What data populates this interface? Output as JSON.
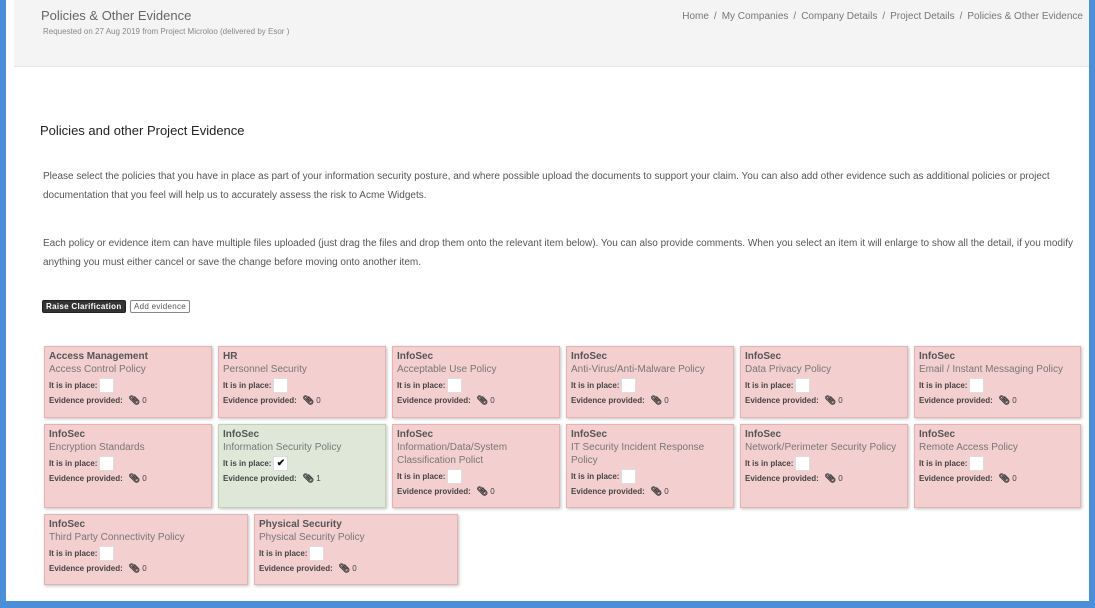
{
  "header": {
    "title": "Policies & Other Evidence",
    "subtitle": "Requested on 27 Aug 2019 from Project Microloo (delivered by Esor )",
    "breadcrumb": [
      "Home",
      "My Companies",
      "Company Details",
      "Project Details",
      "Policies & Other Evidence"
    ],
    "separator": "/"
  },
  "main": {
    "section_title": "Policies and other Project Evidence",
    "paragraph1": "Please select the policies that you have in place as part of your information security posture, and where possible upload the documents to support your claim. You can also add other evidence such as additional policies or project documentation that you feel will help us to accurately assess the risk to Acme Widgets.",
    "paragraph2": "Each policy or evidence item can have multiple files uploaded (just drag the files and drop them onto the relevant item below). You can also provide comments. When you select an item it will enlarge to show all the detail, if you modify anything you must either cancel or save the change before moving onto another item.",
    "raise_label": "Raise Clarification",
    "add_label": "Add evidence"
  },
  "labels": {
    "in_place": "It is in place:",
    "evidence": "Evidence provided:"
  },
  "colors": {
    "missing_card": "#f3cfcf",
    "provided_card": "#dfe8d8",
    "frame": "#4a8fd8"
  },
  "cards": [
    {
      "category": "Access Management",
      "name": "Access Control Policy",
      "checked": false,
      "check_mark": "",
      "evidence_count": "0"
    },
    {
      "category": "HR",
      "name": "Personnel Security",
      "checked": false,
      "check_mark": "",
      "evidence_count": "0"
    },
    {
      "category": "InfoSec",
      "name": "Acceptable Use Policy",
      "checked": false,
      "check_mark": "",
      "evidence_count": "0"
    },
    {
      "category": "InfoSec",
      "name": "Anti-Virus/Anti-Malware Policy",
      "checked": false,
      "check_mark": "",
      "evidence_count": "0"
    },
    {
      "category": "InfoSec",
      "name": "Data Privacy Policy",
      "checked": false,
      "check_mark": "",
      "evidence_count": "0"
    },
    {
      "category": "InfoSec",
      "name": "Email / Instant Messaging Policy",
      "checked": false,
      "check_mark": "",
      "evidence_count": "0"
    },
    {
      "category": "InfoSec",
      "name": "Encryption Standards",
      "checked": false,
      "check_mark": "",
      "evidence_count": "0"
    },
    {
      "category": "InfoSec",
      "name": "Information Security Policy",
      "checked": true,
      "check_mark": "✔",
      "evidence_count": "1"
    },
    {
      "category": "InfoSec",
      "name": "Information/Data/System Classification Polict",
      "checked": false,
      "check_mark": "",
      "evidence_count": "0"
    },
    {
      "category": "InfoSec",
      "name": "IT Security Incident Response Policy",
      "checked": false,
      "check_mark": "",
      "evidence_count": "0"
    },
    {
      "category": "InfoSec",
      "name": "Network/Perimeter Security Policy",
      "checked": false,
      "check_mark": "",
      "evidence_count": "0"
    },
    {
      "category": "InfoSec",
      "name": "Remote Access Policy",
      "checked": false,
      "check_mark": "",
      "evidence_count": "0"
    },
    {
      "category": "InfoSec",
      "name": "Third Party Connectivity Policy",
      "checked": false,
      "check_mark": "",
      "evidence_count": "0"
    },
    {
      "category": "Physical Security",
      "name": "Physical Security Policy",
      "checked": false,
      "check_mark": "",
      "evidence_count": "0"
    }
  ]
}
